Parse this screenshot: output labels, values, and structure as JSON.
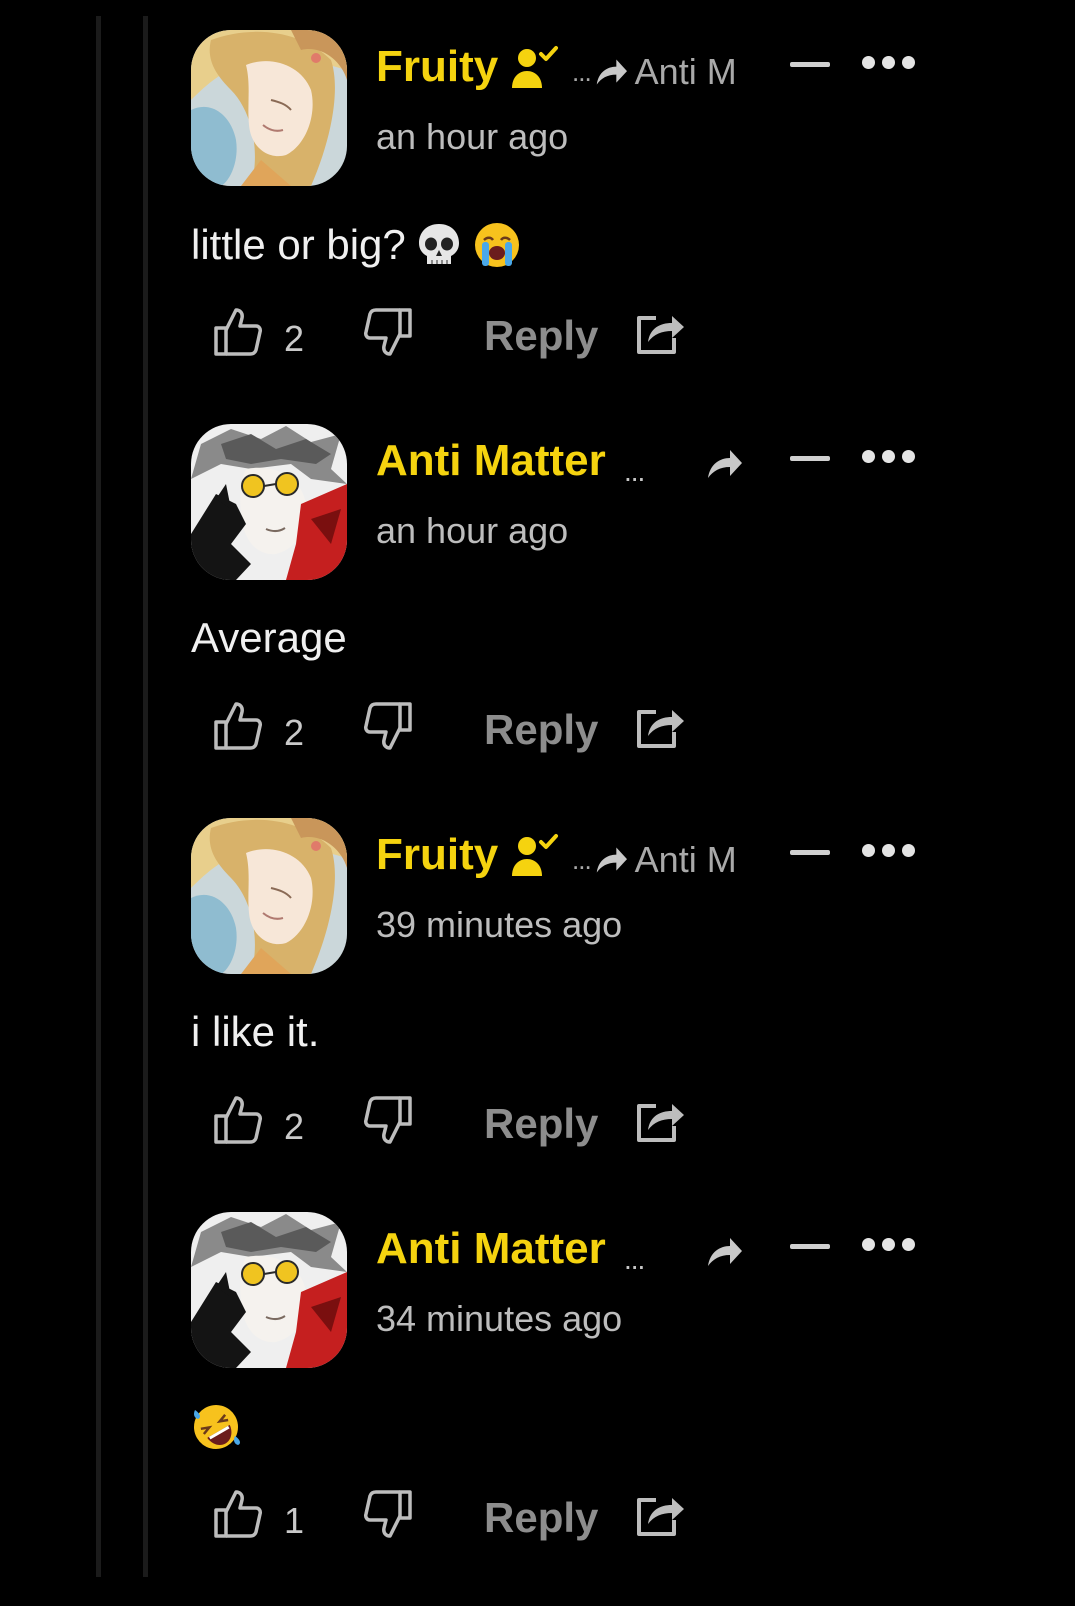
{
  "comments": [
    {
      "user": "Fruity",
      "badge": "verified-user-icon",
      "reply_to": "Anti M",
      "reply_to_prefix": "...",
      "time": "an hour ago",
      "text": "little or big?",
      "emojis": [
        "skull",
        "loudly-crying-face"
      ],
      "likes": "2",
      "reply_label": "Reply"
    },
    {
      "user": "Anti Matter",
      "trail": "...",
      "time": "an hour ago",
      "text": "Average",
      "likes": "2",
      "reply_label": "Reply"
    },
    {
      "user": "Fruity",
      "badge": "verified-user-icon",
      "reply_to": "Anti M",
      "reply_to_prefix": "...",
      "time": "39 minutes ago",
      "text": "i like it.",
      "likes": "2",
      "reply_label": "Reply"
    },
    {
      "user": "Anti Matter",
      "trail": "...",
      "time": "34 minutes ago",
      "text": "",
      "emojis": [
        "rolling-on-the-floor-laughing"
      ],
      "likes": "1",
      "reply_label": "Reply"
    }
  ],
  "colors": {
    "background": "#000000",
    "username": "#f5d30f",
    "muted": "#bdbdbd"
  }
}
